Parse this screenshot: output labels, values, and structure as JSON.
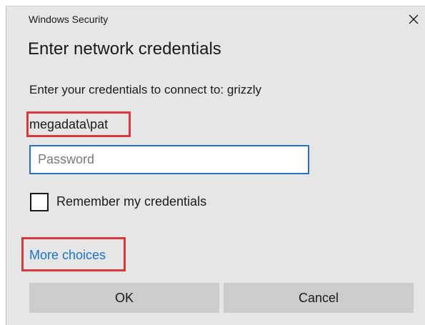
{
  "window": {
    "title": "Windows Security",
    "close_icon": "close-icon"
  },
  "dialog": {
    "heading": "Enter network credentials",
    "connect_text": "Enter your credentials to connect to: grizzly",
    "username": "megadata\\pat",
    "password": {
      "value": "",
      "placeholder": "Password"
    },
    "remember": {
      "label": "Remember my credentials",
      "checked": false
    },
    "more_choices": "More choices",
    "ok_label": "OK",
    "cancel_label": "Cancel"
  },
  "colors": {
    "dialog_background": "#e6e6e6",
    "highlight_border": "#d23c3c",
    "link": "#1a73c7",
    "input_focus_border": "#2a6ec2",
    "button_background": "#cccccc"
  }
}
